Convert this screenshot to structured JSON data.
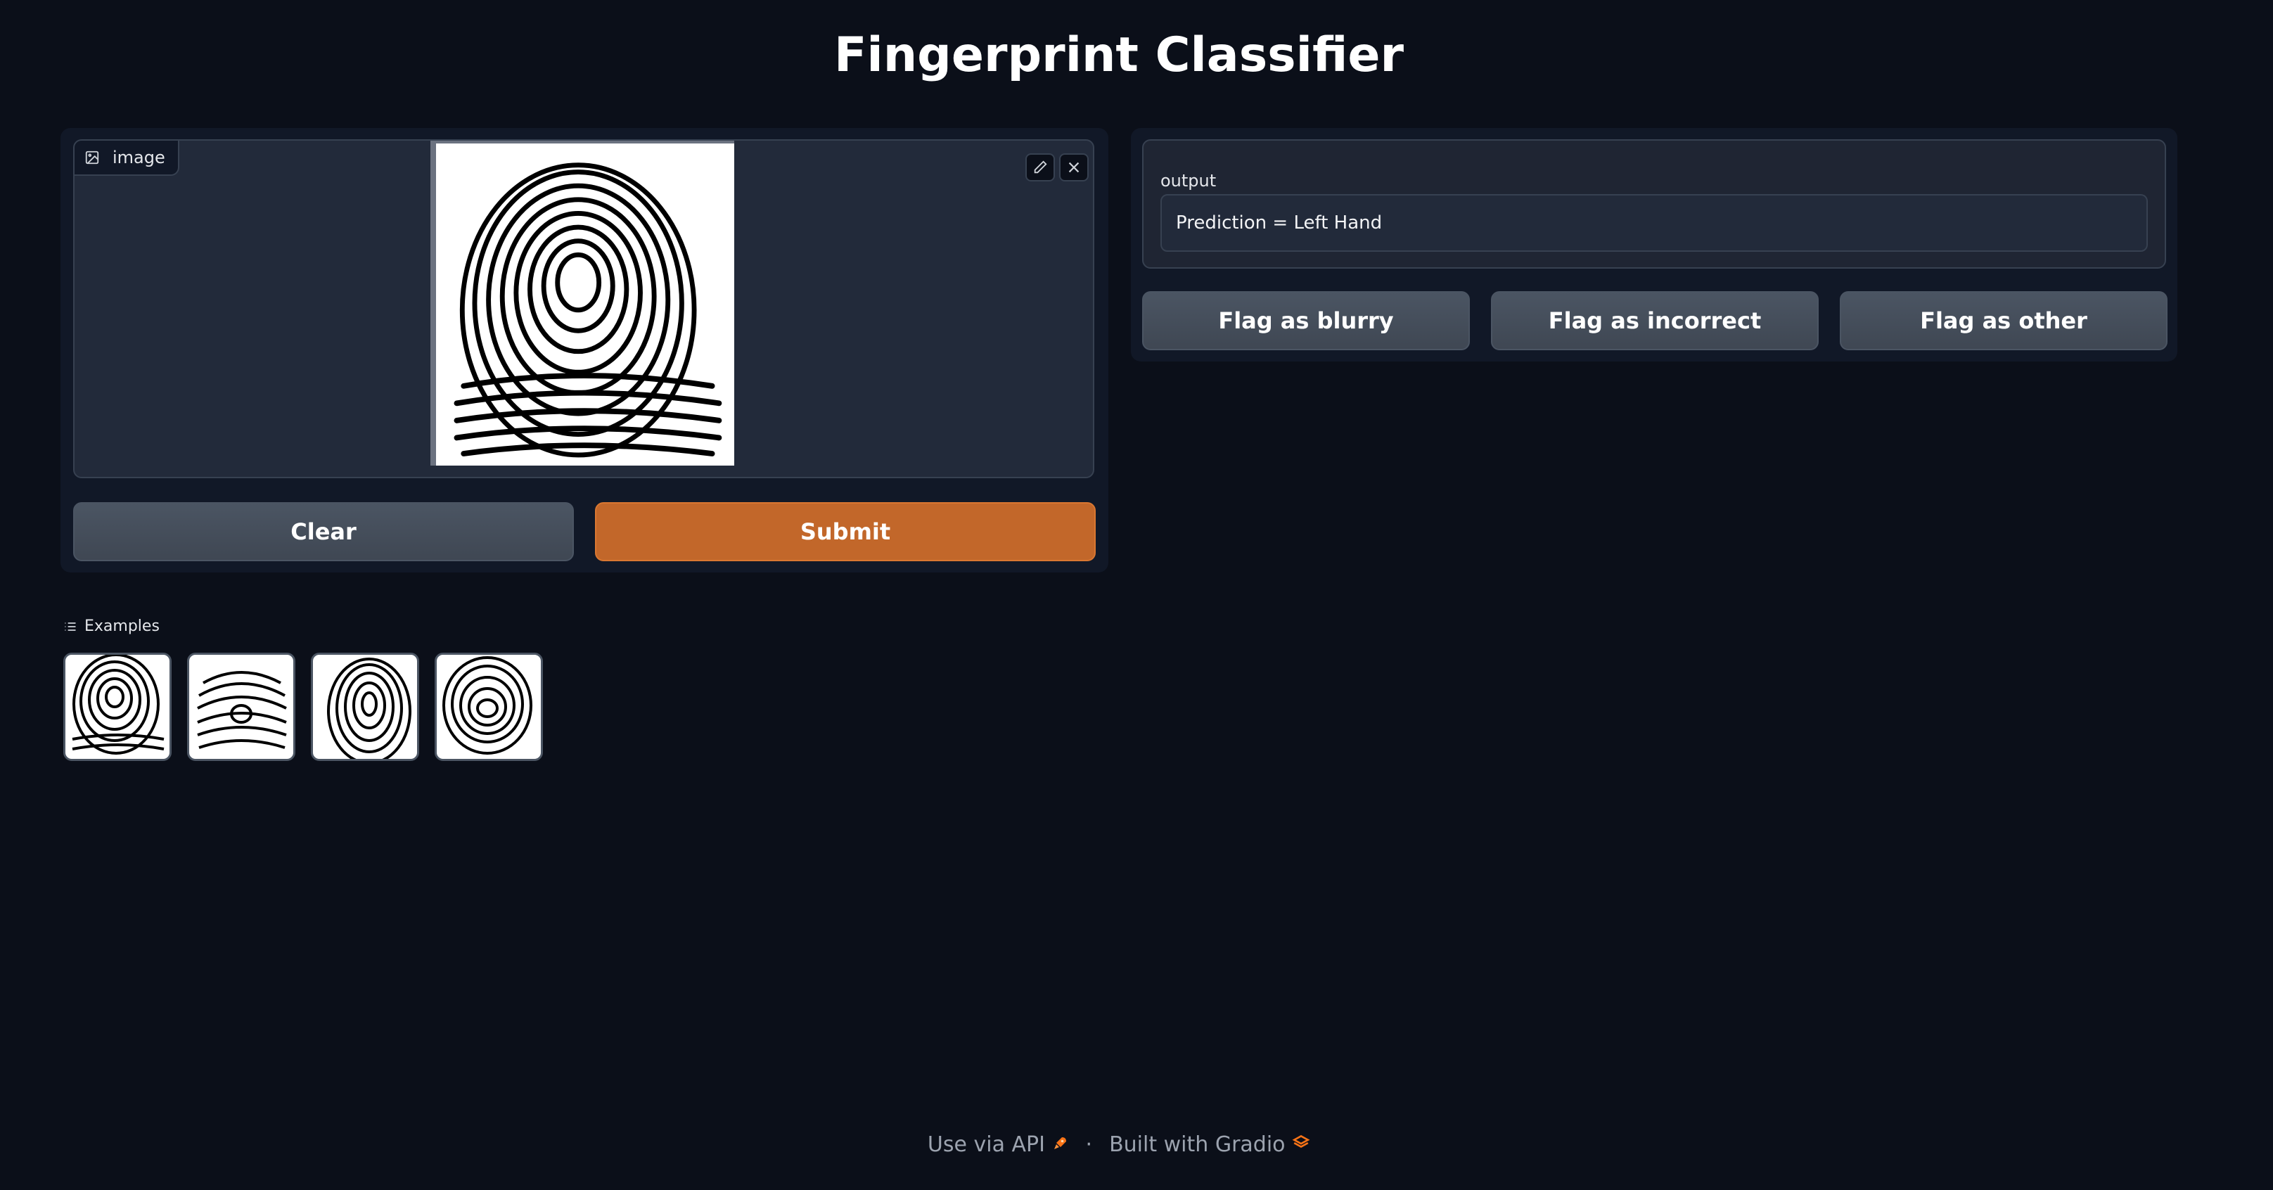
{
  "app": {
    "title": "Fingerprint Classifier"
  },
  "input": {
    "image_label": "image",
    "clear_label": "Clear",
    "submit_label": "Submit"
  },
  "output": {
    "label": "output",
    "value": "Prediction = Left Hand",
    "flag_buttons": [
      "Flag as blurry",
      "Flag as incorrect",
      "Flag as other"
    ]
  },
  "examples": {
    "label": "Examples",
    "count": 4
  },
  "footer": {
    "api_text": "Use via API",
    "separator": "·",
    "built_text": "Built with Gradio"
  },
  "colors": {
    "background": "#0b0f19",
    "panel": "#111827",
    "primary": "#c2672a",
    "secondary": "#4b5563"
  }
}
